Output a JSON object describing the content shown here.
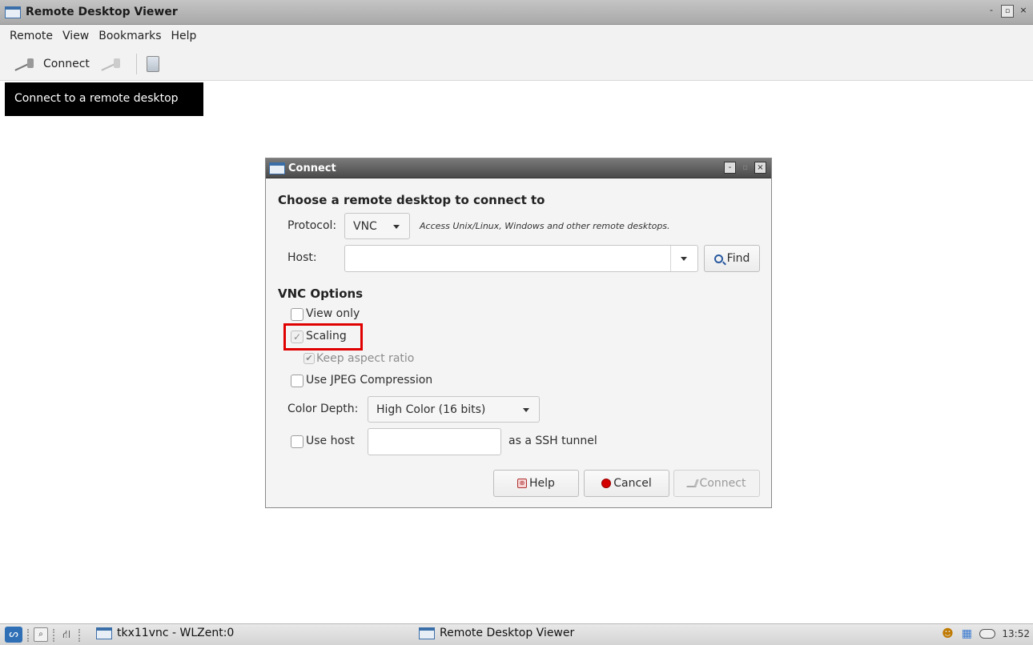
{
  "window": {
    "title": "Remote Desktop Viewer",
    "controls": {
      "minimize": "-",
      "maximize": "▫",
      "close": "×"
    }
  },
  "menubar": {
    "items": [
      "Remote",
      "View",
      "Bookmarks",
      "Help"
    ]
  },
  "toolbar": {
    "connect_label": "Connect",
    "tooltip": "Connect to a remote desktop"
  },
  "dialog": {
    "title": "Connect",
    "heading": "Choose a remote desktop to connect to",
    "protocol_label": "Protocol:",
    "protocol_value": "VNC",
    "protocol_hint": "Access Unix/Linux, Windows and other remote desktops.",
    "host_label": "Host:",
    "host_value": "",
    "find_label": "Find",
    "vnc_options_heading": "VNC Options",
    "view_only_label": "View only",
    "view_only_checked": false,
    "scaling_label": "Scaling",
    "scaling_checked": true,
    "keep_aspect_label": "Keep aspect ratio",
    "keep_aspect_checked": true,
    "jpeg_label": "Use JPEG Compression",
    "jpeg_checked": false,
    "color_depth_label": "Color Depth:",
    "color_depth_value": "High Color (16 bits)",
    "use_host_label": "Use host",
    "use_host_checked": false,
    "ssh_host_value": "",
    "ssh_suffix": "as a SSH tunnel",
    "help_button": "Help",
    "cancel_button": "Cancel",
    "connect_button": "Connect",
    "check_mark": "✓",
    "check_mark_bold": "✔"
  },
  "taskbar": {
    "tasks": [
      {
        "label": "tkx11vnc - WLZent:0"
      },
      {
        "label": "Remote Desktop Viewer"
      }
    ],
    "clock": "13:52"
  },
  "colors": {
    "highlight": "#e00000",
    "dialog_titlebar": "#4a4a4a",
    "tooltip_bg": "#000000",
    "accent_blue": "#3a6ea8"
  }
}
